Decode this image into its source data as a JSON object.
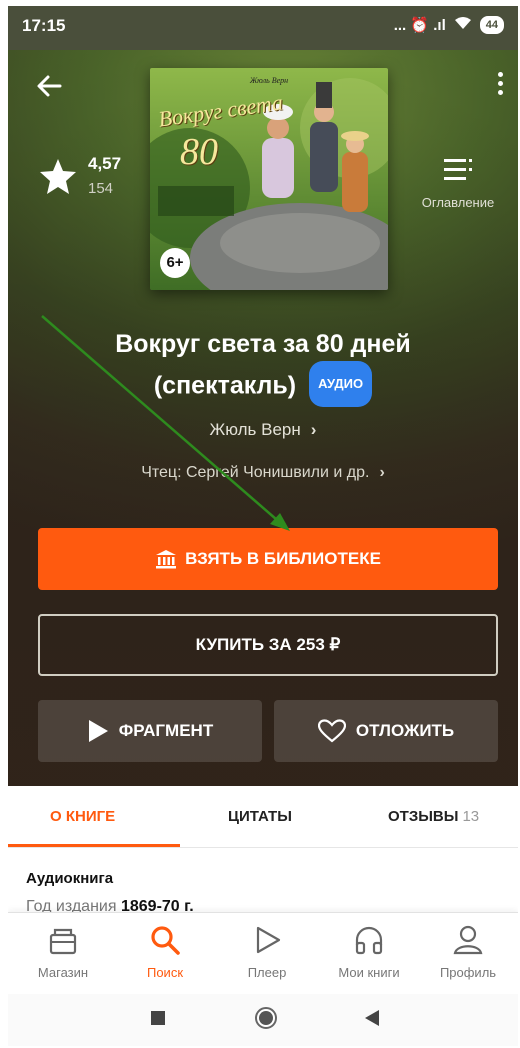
{
  "status": {
    "time": "17:15",
    "signal": "... ⏰ .ıl",
    "battery": "44"
  },
  "rating": {
    "score": "4,57",
    "count": "154"
  },
  "toc_label": "Оглавление",
  "cover": {
    "author_small": "Жюль Верн",
    "title": "Вокруг света",
    "number": "80",
    "age": "6+"
  },
  "book": {
    "title_line1": "Вокруг света за 80 дней",
    "title_line2": "(спектакль)",
    "badge": "АУДИО",
    "author": "Жюль Верн",
    "reader": "Чтец: Сергей Чонишвили и др."
  },
  "actions": {
    "take_library": "ВЗЯТЬ В БИБЛИОТЕКЕ",
    "buy": "КУПИТЬ ЗА 253 ₽",
    "fragment": "ФРАГМЕНТ",
    "postpone": "ОТЛОЖИТЬ"
  },
  "tabs": [
    {
      "label": "О КНИГЕ"
    },
    {
      "label": "ЦИТАТЫ"
    },
    {
      "label": "ОТЗЫВЫ",
      "count": "13"
    }
  ],
  "about": {
    "kind": "Аудиокнига",
    "year_label": "Год издания",
    "year_value": "1869-70 г."
  },
  "nav": [
    {
      "label": "Магазин",
      "icon": "shop-icon"
    },
    {
      "label": "Поиск",
      "icon": "search-icon"
    },
    {
      "label": "Плеер",
      "icon": "play-icon"
    },
    {
      "label": "Мои книги",
      "icon": "headphones-icon"
    },
    {
      "label": "Профиль",
      "icon": "profile-icon"
    }
  ],
  "colors": {
    "accent": "#ff5a0f",
    "badge": "#2f80ed",
    "annotation_arrow": "#2e8b1e"
  }
}
